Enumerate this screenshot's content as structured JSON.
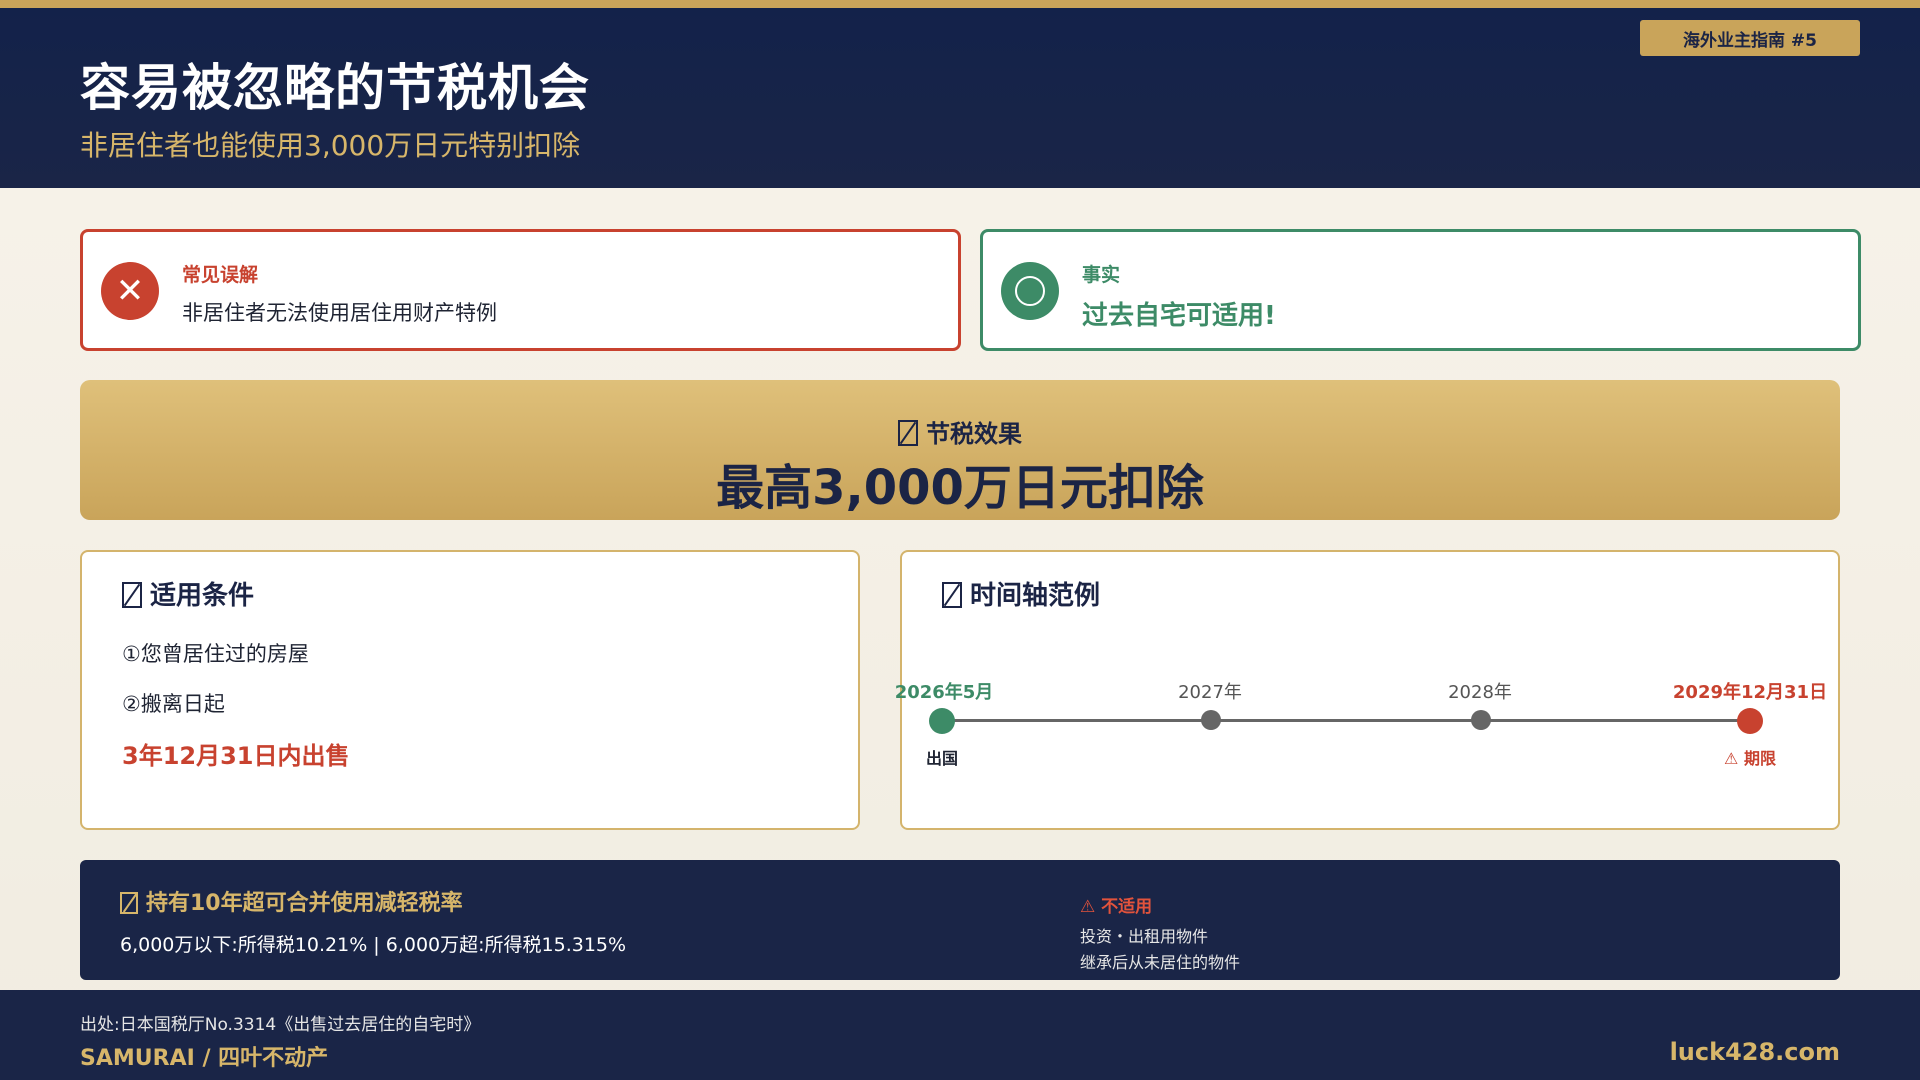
{
  "header": {
    "badge": "海外业主指南 #5",
    "title": "容易被忽略的节税机会",
    "subtitle": "非居住者也能使用3,000万日元特别扣除"
  },
  "myth": {
    "icon": "x-icon",
    "tag": "常见误解",
    "text": "非居住者无法使用居住用财产特例"
  },
  "fact": {
    "icon": "circle-icon",
    "tag": "事实",
    "text": "过去自宅可适用!"
  },
  "effect": {
    "label": "节税效果",
    "value": "最高3,000万日元扣除"
  },
  "conditions": {
    "title": "适用条件",
    "items": [
      "①您曾居住过的房屋",
      "②搬离日起"
    ],
    "highlight": "3年12月31日内出售"
  },
  "timeline": {
    "title": "时间轴范例",
    "points": [
      {
        "label": "2026年5月",
        "sub": "出国",
        "color": "#3d8b67"
      },
      {
        "label": "2027年",
        "sub": "",
        "color": "#666666"
      },
      {
        "label": "2028年",
        "sub": "",
        "color": "#666666"
      },
      {
        "label": "2029年12月31日",
        "sub": "⚠ 期限",
        "color": "#c8422f"
      }
    ]
  },
  "bottom": {
    "title": "持有10年超可合并使用减轻税率",
    "rates": "6,000万以下:所得税10.21%   |   6,000万超:所得税15.315%",
    "not_applicable_title": "⚠ 不适用",
    "not_applicable_items": [
      "投资・出租用物件",
      "继承后从未居住的物件"
    ]
  },
  "footer": {
    "source": "出处:日本国税厅No.3314《出售过去居住的自宅时》",
    "brand": "SAMURAI / 四叶不动产",
    "site": "luck428.com"
  },
  "colors": {
    "navy": "#1a2547",
    "gold": "#c9a45a",
    "red": "#c8422f",
    "green": "#3d8b67"
  }
}
